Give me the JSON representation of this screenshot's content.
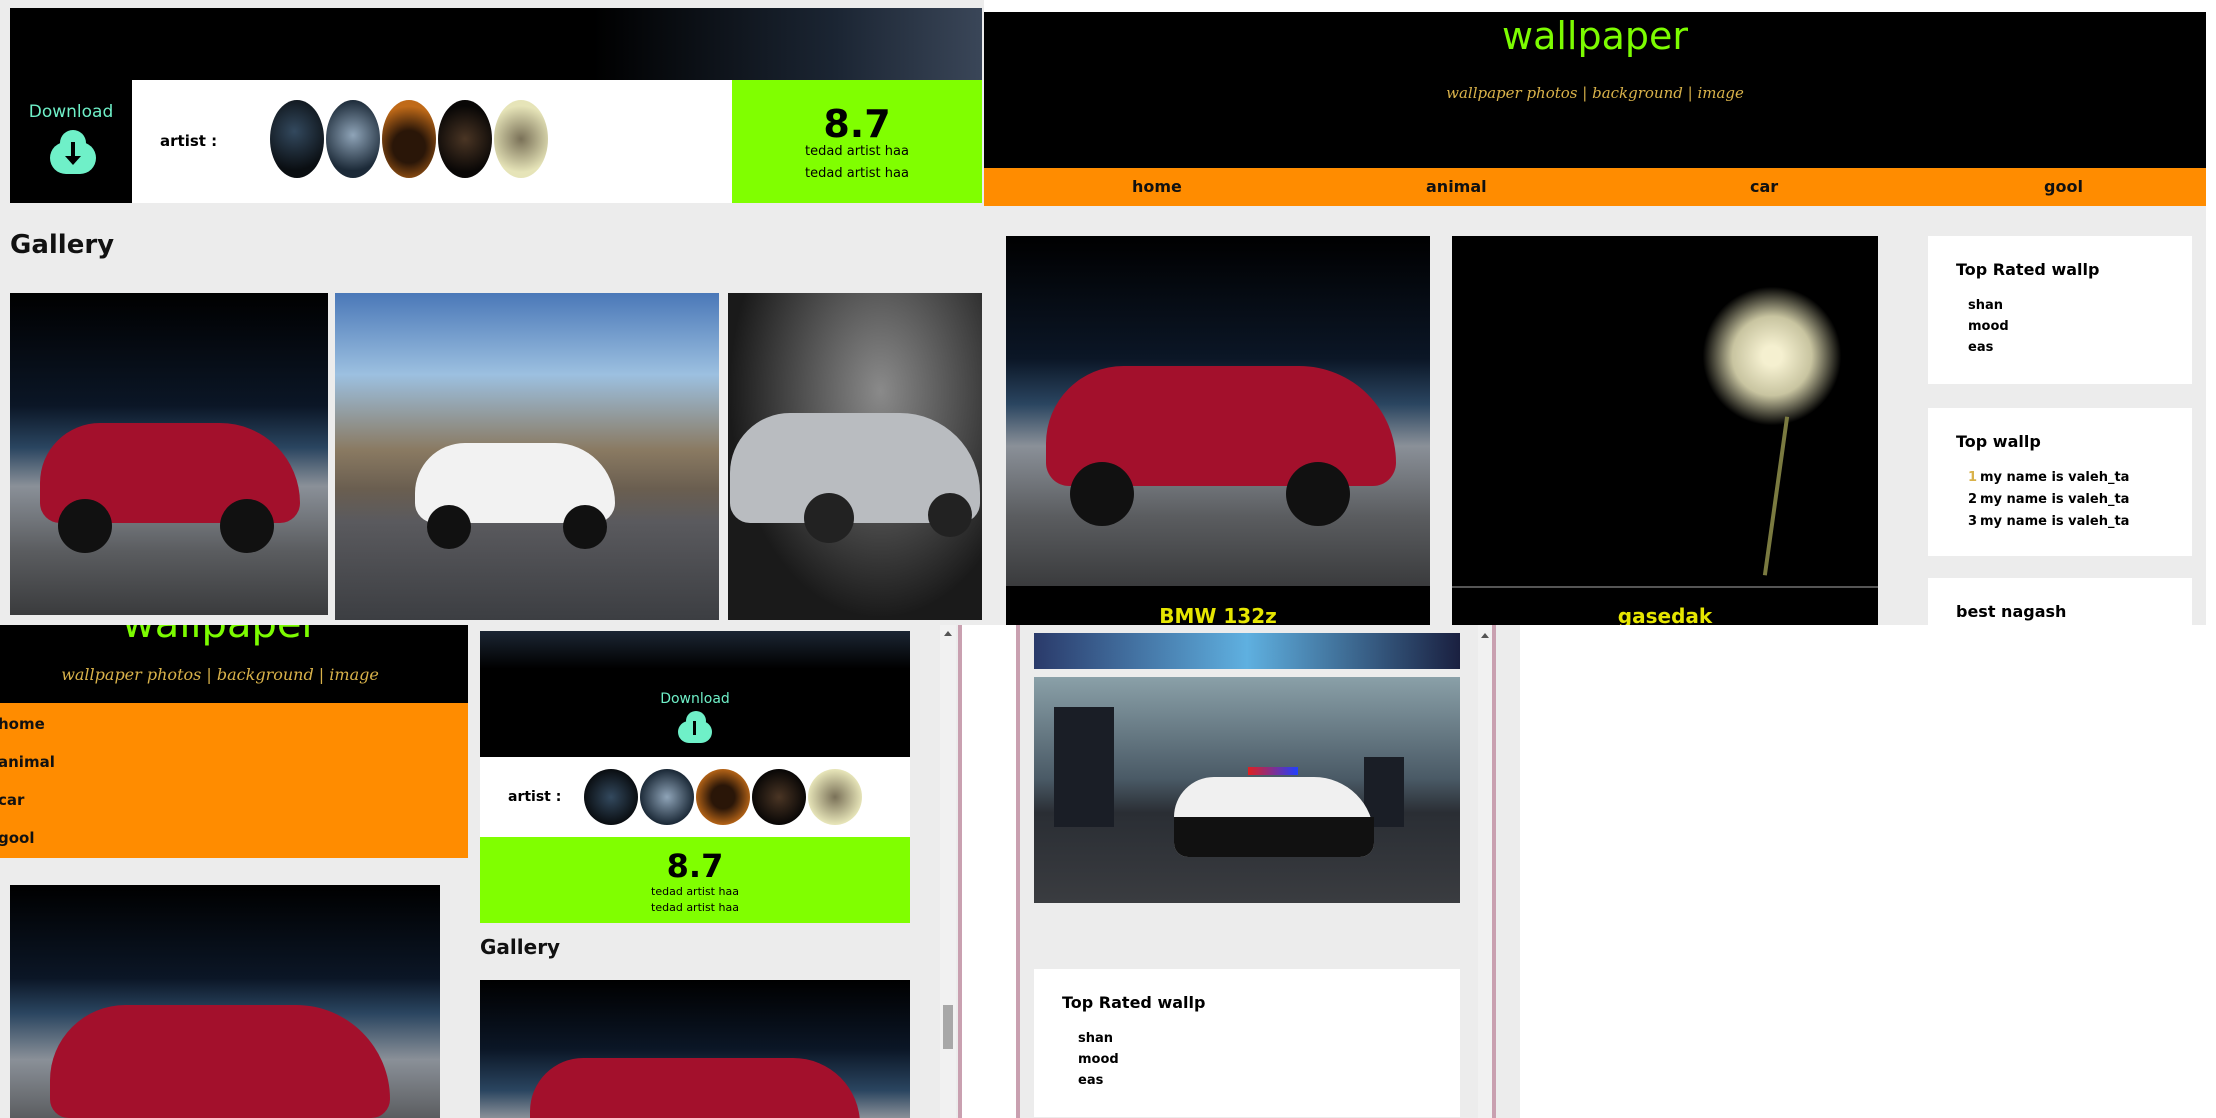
{
  "site": {
    "title": "wallpaper",
    "subtitle": "wallpaper photos | background | image",
    "nav": [
      "home",
      "animal",
      "car",
      "gool"
    ]
  },
  "artist_header": {
    "download_label": "Download",
    "artist_label": "artist :",
    "score": "8.7",
    "score_line1": "tedad artist haa",
    "score_line2": "tedad artist haa"
  },
  "gallery": {
    "heading": "Gallery"
  },
  "cards": {
    "bmw_caption": "BMW 132z",
    "gasedak_caption": "gasedak"
  },
  "sidebar": {
    "top_rated_title": "Top Rated wallp",
    "top_rated_items": [
      "shan",
      "mood",
      "eas"
    ],
    "top_wallp_title": "Top wallp",
    "top_wallp_items": [
      "1",
      "my name is valeh_ta",
      "2",
      "my name is valeh_ta",
      "3",
      "my name is valeh_ta"
    ],
    "best_title": "best nagash"
  },
  "icons": [
    "download-cloud-icon",
    "scroll-up-arrow-icon"
  ],
  "colors": {
    "accent_green": "#80ff00",
    "nav_orange": "#ff8c00",
    "download_mint": "#6ff0c8",
    "subtitle_gold": "#d9b24a",
    "caption_yellow": "#e6e600"
  }
}
